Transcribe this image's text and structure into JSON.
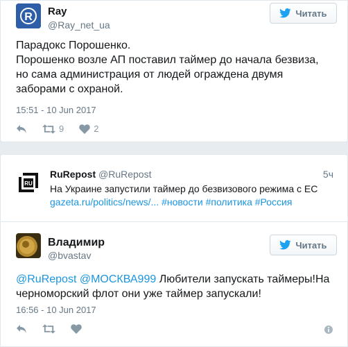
{
  "tweet1": {
    "name": "Ray",
    "handle": "@Ray_net_ua",
    "follow_label": "Читать",
    "lines": [
      "Парадокс Порошенко.",
      "Порошенко возле АП поставил таймер до начала безвиза,",
      "но сама администрация от людей ограждена двумя",
      "заборами с охраной."
    ],
    "timestamp": "15:51 - 10 Jun 2017",
    "retweets": "9",
    "likes": "2"
  },
  "quoted": {
    "name": "RuRepost",
    "handle": "@RuRepost",
    "age": "5ч",
    "text": "На Украине запустили таймер до безвизового режима с ЕС",
    "link": "gazeta.ru/politics/news/...",
    "hashtags": [
      "#новости",
      "#политика",
      "#Россия"
    ],
    "avatar_text": "RU"
  },
  "tweet2": {
    "name": "Владимир",
    "handle": "@bvastav",
    "follow_label": "Читать",
    "mentions": [
      "@RuRepost",
      "@МОСКВА999"
    ],
    "text_line1_rest": "Любители запускать таймеры!На",
    "text_line2": "черноморский флот они уже таймер запускали!",
    "timestamp": "16:56 - 10 Jun 2017"
  },
  "colors": {
    "link": "#1b95e0",
    "twitter_blue": "#1da1f2",
    "muted": "#657786"
  }
}
